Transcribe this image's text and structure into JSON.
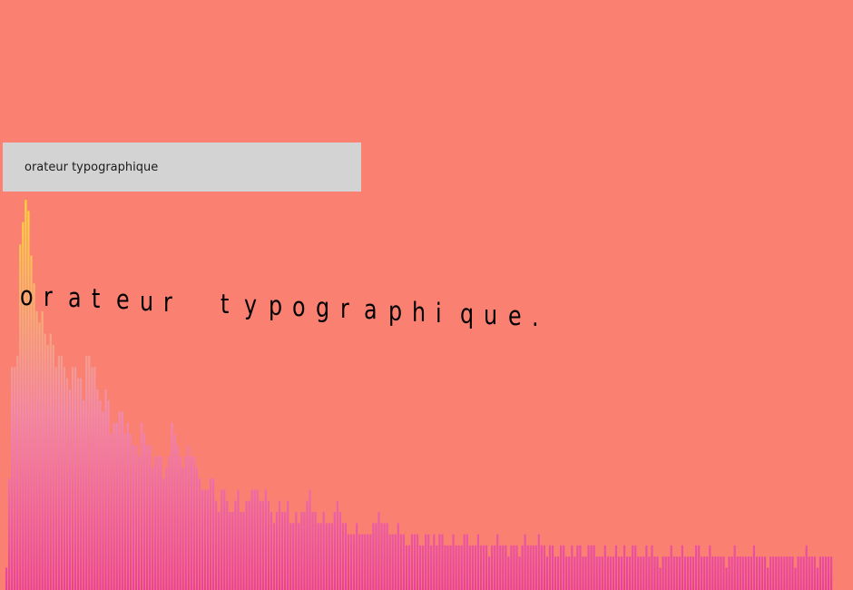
{
  "input": {
    "value": "orateur typographique"
  },
  "headline": {
    "text": "orateur typographique."
  },
  "colors": {
    "background": "#fa8072",
    "input_bg": "#d3d3d3",
    "bar_top": "#fdd835",
    "bar_bottom": "#e8409a"
  },
  "spectrum": {
    "levels": [
      0.04,
      0.2,
      0.4,
      0.4,
      0.42,
      0.62,
      0.66,
      0.7,
      0.68,
      0.6,
      0.55,
      0.5,
      0.48,
      0.5,
      0.46,
      0.44,
      0.46,
      0.44,
      0.4,
      0.42,
      0.42,
      0.4,
      0.38,
      0.36,
      0.4,
      0.4,
      0.38,
      0.38,
      0.34,
      0.42,
      0.42,
      0.4,
      0.4,
      0.36,
      0.34,
      0.32,
      0.36,
      0.34,
      0.28,
      0.3,
      0.3,
      0.32,
      0.32,
      0.28,
      0.3,
      0.28,
      0.26,
      0.26,
      0.24,
      0.3,
      0.28,
      0.26,
      0.26,
      0.22,
      0.24,
      0.24,
      0.24,
      0.2,
      0.22,
      0.24,
      0.3,
      0.28,
      0.26,
      0.24,
      0.22,
      0.24,
      0.26,
      0.24,
      0.24,
      0.22,
      0.2,
      0.18,
      0.18,
      0.18,
      0.2,
      0.2,
      0.16,
      0.14,
      0.18,
      0.18,
      0.16,
      0.14,
      0.14,
      0.16,
      0.18,
      0.14,
      0.14,
      0.16,
      0.16,
      0.18,
      0.18,
      0.18,
      0.16,
      0.16,
      0.18,
      0.16,
      0.14,
      0.12,
      0.14,
      0.16,
      0.14,
      0.14,
      0.16,
      0.12,
      0.12,
      0.14,
      0.12,
      0.14,
      0.14,
      0.16,
      0.18,
      0.14,
      0.14,
      0.12,
      0.12,
      0.14,
      0.12,
      0.12,
      0.12,
      0.14,
      0.16,
      0.14,
      0.12,
      0.12,
      0.1,
      0.1,
      0.1,
      0.12,
      0.1,
      0.1,
      0.1,
      0.1,
      0.1,
      0.12,
      0.12,
      0.14,
      0.12,
      0.12,
      0.12,
      0.1,
      0.1,
      0.1,
      0.12,
      0.1,
      0.1,
      0.08,
      0.08,
      0.1,
      0.1,
      0.1,
      0.08,
      0.08,
      0.1,
      0.1,
      0.08,
      0.1,
      0.08,
      0.1,
      0.1,
      0.08,
      0.08,
      0.08,
      0.1,
      0.08,
      0.08,
      0.08,
      0.1,
      0.1,
      0.08,
      0.08,
      0.08,
      0.1,
      0.08,
      0.08,
      0.08,
      0.06,
      0.08,
      0.08,
      0.1,
      0.08,
      0.08,
      0.08,
      0.06,
      0.08,
      0.08,
      0.08,
      0.06,
      0.08,
      0.1,
      0.08,
      0.08,
      0.08,
      0.08,
      0.1,
      0.08,
      0.08,
      0.06,
      0.08,
      0.08,
      0.06,
      0.06,
      0.08,
      0.08,
      0.06,
      0.06,
      0.08,
      0.06,
      0.08,
      0.08,
      0.06,
      0.06,
      0.08,
      0.08,
      0.08,
      0.06,
      0.06,
      0.06,
      0.08,
      0.06,
      0.06,
      0.06,
      0.08,
      0.06,
      0.06,
      0.08,
      0.06,
      0.06,
      0.08,
      0.08,
      0.06,
      0.06,
      0.06,
      0.08,
      0.06,
      0.08,
      0.06,
      0.06,
      0.04,
      0.06,
      0.06,
      0.06,
      0.08,
      0.06,
      0.06,
      0.06,
      0.08,
      0.06,
      0.06,
      0.06,
      0.06,
      0.08,
      0.08,
      0.06,
      0.06,
      0.06,
      0.08,
      0.06,
      0.06,
      0.06,
      0.06,
      0.06,
      0.04,
      0.06,
      0.06,
      0.08,
      0.06,
      0.06,
      0.06,
      0.06,
      0.06,
      0.06,
      0.08,
      0.06,
      0.06,
      0.06,
      0.06,
      0.04,
      0.06,
      0.06,
      0.06,
      0.06,
      0.06,
      0.06,
      0.06,
      0.06,
      0.06,
      0.04,
      0.06,
      0.06,
      0.06,
      0.08,
      0.06,
      0.06,
      0.06,
      0.04,
      0.06,
      0.06,
      0.06,
      0.06,
      0.06
    ]
  }
}
